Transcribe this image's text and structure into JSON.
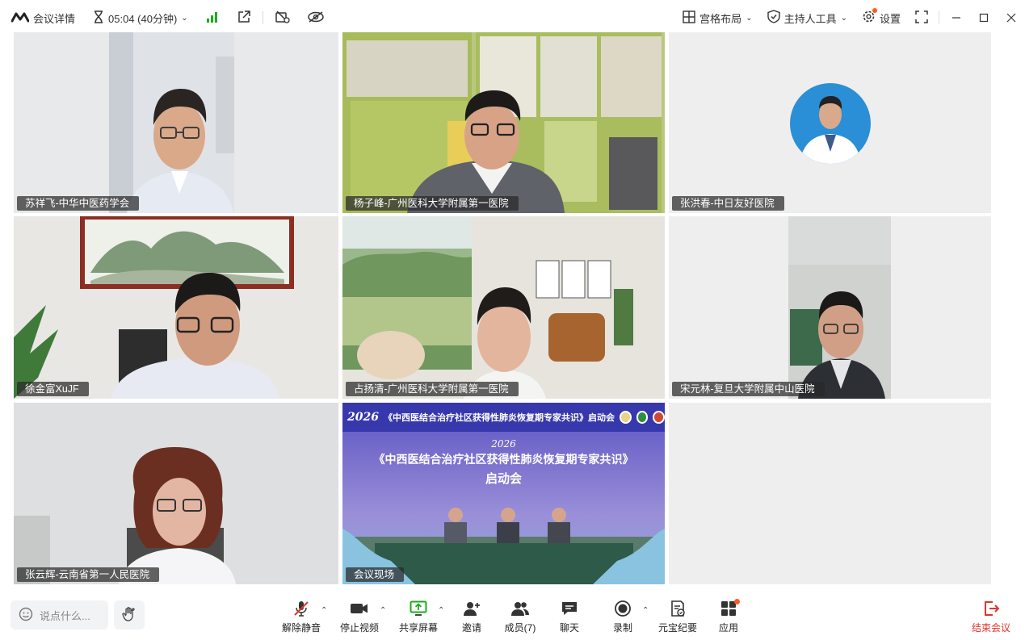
{
  "topbar": {
    "meeting_info_label": "会议详情",
    "timer_text": "05:04 (40分钟)",
    "layout_label": "宫格布局",
    "host_tools_label": "主持人工具",
    "settings_label": "设置"
  },
  "participants": [
    {
      "name": "苏祥飞-中华中医药学会"
    },
    {
      "name": "杨子峰-广州医科大学附属第一医院"
    },
    {
      "name": "张洪春-中日友好医院"
    },
    {
      "name": "徐金富XuJF"
    },
    {
      "name": "占扬清-广州医科大学附属第一医院"
    },
    {
      "name": "宋元林-复旦大学附属中山医院"
    },
    {
      "name": "张云辉-云南省第一人民医院"
    },
    {
      "name": "会议现场"
    }
  ],
  "venue_screen": {
    "header_title": "《中西医结合治疗社区获得性肺炎恢复期专家共识》启动会",
    "year_mark": "2026",
    "main_title": "《中西医结合治疗社区获得性肺炎恢复期专家共识》",
    "sub_title": "启动会"
  },
  "bottombar": {
    "chat_placeholder": "说点什么...",
    "unmute_label": "解除静音",
    "stop_video_label": "停止视频",
    "share_screen_label": "共享屏幕",
    "invite_label": "邀请",
    "members_label": "成员(7)",
    "chat_label": "聊天",
    "record_label": "录制",
    "yuanbao_label": "元宝纪要",
    "apps_label": "应用",
    "end_meeting_label": "结束会议"
  },
  "colors": {
    "accent_green": "#1aad19",
    "end_red": "#e0352b",
    "badge_orange": "#ff5a1f"
  }
}
